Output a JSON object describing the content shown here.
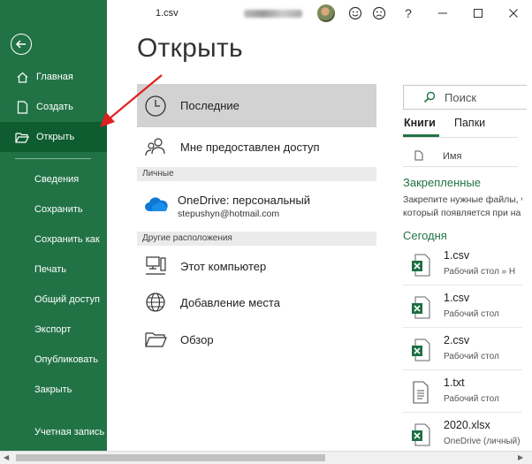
{
  "window": {
    "doc_title": "1.csv",
    "smile_icon": "smile-icon",
    "frown_icon": "frown-icon",
    "help": "?",
    "minimize": "minimize-icon",
    "maximize": "maximize-icon",
    "close": "close-icon"
  },
  "colors": {
    "accent": "#217346",
    "accent_dark": "#0e5c2f",
    "annotation": "#e02020"
  },
  "sidebar": {
    "items": [
      {
        "label": "Главная",
        "icon": "home-icon"
      },
      {
        "label": "Создать",
        "icon": "new-document-icon"
      },
      {
        "label": "Открыть",
        "icon": "open-folder-icon",
        "active": true
      },
      {
        "label": "Сведения"
      },
      {
        "label": "Сохранить"
      },
      {
        "label": "Сохранить как"
      },
      {
        "label": "Печать"
      },
      {
        "label": "Общий доступ"
      },
      {
        "label": "Экспорт"
      },
      {
        "label": "Опубликовать"
      },
      {
        "label": "Закрыть"
      },
      {
        "label": "Учетная запись"
      }
    ]
  },
  "main": {
    "title": "Открыть",
    "recent": "Последние",
    "shared": "Мне предоставлен доступ",
    "personal_header": "Личные",
    "onedrive_title": "OneDrive: персональный",
    "onedrive_email": "stepushyn@hotmail.com",
    "other_header": "Другие расположения",
    "this_pc": "Этот компьютер",
    "add_place": "Добавление места",
    "browse": "Обзор"
  },
  "right": {
    "search_placeholder": "Поиск",
    "tab_books": "Книги",
    "tab_folders": "Папки",
    "col_name": "Имя",
    "pinned_title": "Закрепленные",
    "pinned_hint_1": "Закрепите нужные файлы, ч",
    "pinned_hint_2": "который появляется при на",
    "today_title": "Сегодня",
    "files": [
      {
        "name": "1.csv",
        "location": "Рабочий стол » Н",
        "icon": "excel-file-icon"
      },
      {
        "name": "1.csv",
        "location": "Рабочий стол",
        "icon": "excel-file-icon"
      },
      {
        "name": "2.csv",
        "location": "Рабочий стол",
        "icon": "excel-file-icon"
      },
      {
        "name": "1.txt",
        "location": "Рабочий стол",
        "icon": "text-file-icon"
      },
      {
        "name": "2020.xlsx",
        "location": "OneDrive (личный)",
        "icon": "excel-file-icon"
      }
    ]
  }
}
